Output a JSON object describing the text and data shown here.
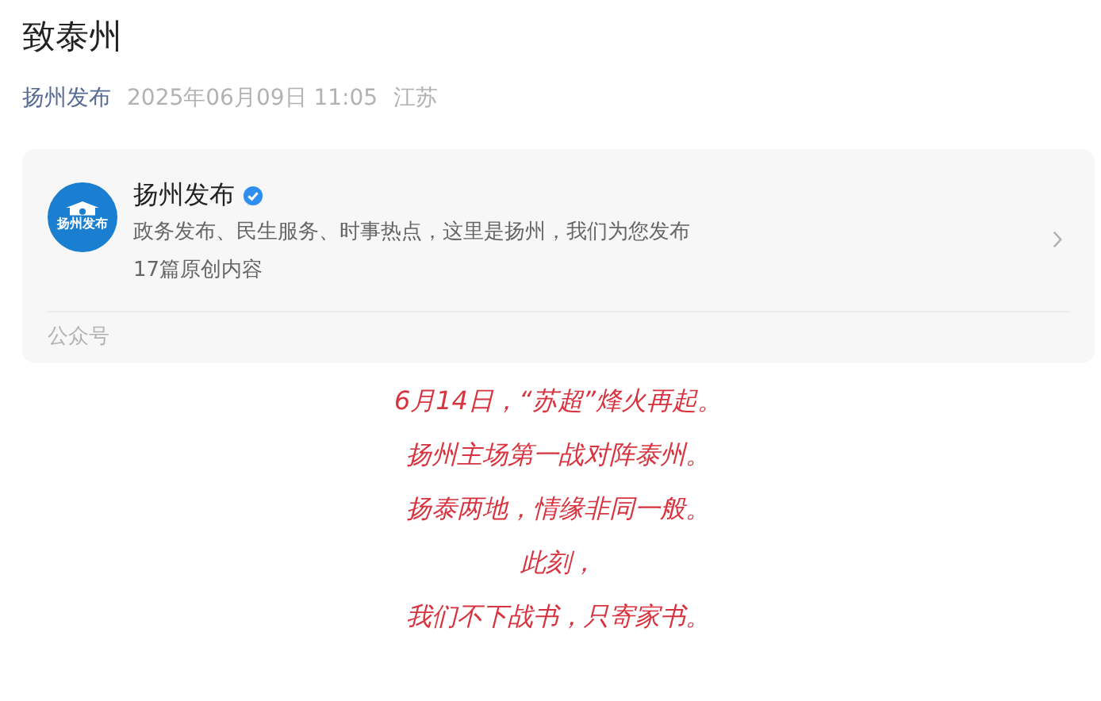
{
  "title": "致泰州",
  "meta": {
    "author": "扬州发布",
    "datetime": "2025年06月09日 11:05",
    "location": "江苏"
  },
  "account_card": {
    "logo_text": "扬州发布",
    "name": "扬州发布",
    "verified": true,
    "description": "政务发布、民生服务、时事热点，这里是扬州，我们为您发布",
    "count": "17篇原创内容",
    "footer": "公众号"
  },
  "body_lines": [
    "6月14日，“苏超”烽火再起。",
    "扬州主场第一战对阵泰州。",
    "扬泰两地，情缘非同一般。",
    "此刻，",
    "我们不下战书，只寄家书。"
  ]
}
